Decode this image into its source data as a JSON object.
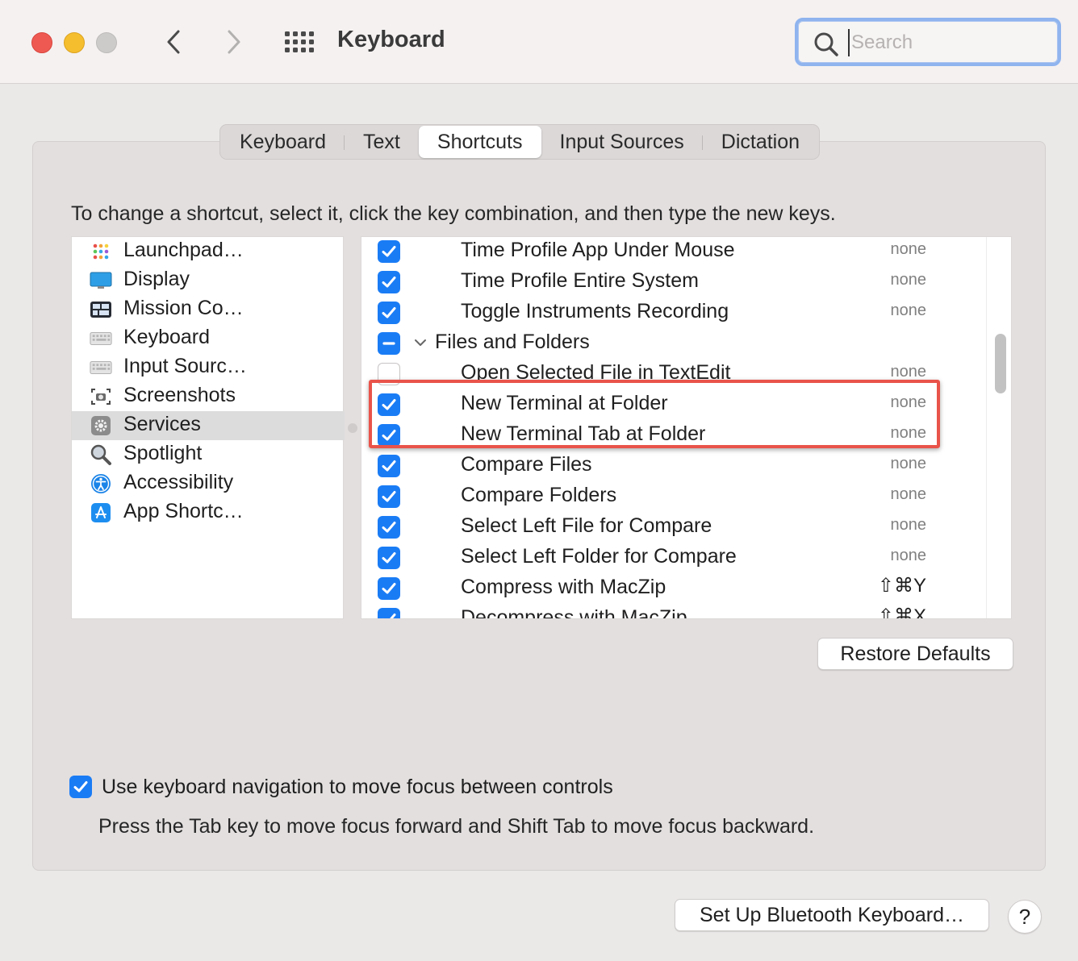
{
  "window": {
    "title": "Keyboard",
    "search_placeholder": "Search"
  },
  "tabs": [
    {
      "label": "Keyboard"
    },
    {
      "label": "Text"
    },
    {
      "label": "Shortcuts",
      "active": true
    },
    {
      "label": "Input Sources"
    },
    {
      "label": "Dictation"
    }
  ],
  "instruction": "To change a shortcut, select it, click the key combination, and then type the new keys.",
  "categories": [
    {
      "label": "Launchpad…",
      "icon": "launchpad-icon"
    },
    {
      "label": "Display",
      "icon": "display-icon"
    },
    {
      "label": "Mission Co…",
      "icon": "mission-control-icon"
    },
    {
      "label": "Keyboard",
      "icon": "keyboard-icon"
    },
    {
      "label": "Input Sourc…",
      "icon": "input-sources-icon"
    },
    {
      "label": "Screenshots",
      "icon": "screenshot-icon"
    },
    {
      "label": "Services",
      "icon": "gear-icon",
      "selected": true
    },
    {
      "label": "Spotlight",
      "icon": "magnifier-icon"
    },
    {
      "label": "Accessibility",
      "icon": "accessibility-icon"
    },
    {
      "label": "App Shortc…",
      "icon": "app-store-icon"
    }
  ],
  "shortcuts": [
    {
      "label": "Time Profile App Under Mouse",
      "shortcut": "none",
      "checked": "on"
    },
    {
      "label": "Time Profile Entire System",
      "shortcut": "none",
      "checked": "on"
    },
    {
      "label": "Toggle Instruments Recording",
      "shortcut": "none",
      "checked": "on"
    },
    {
      "label": "Files and Folders",
      "shortcut": "",
      "checked": "mixed",
      "group": true
    },
    {
      "label": "Open Selected File in TextEdit",
      "shortcut": "none",
      "checked": "off"
    },
    {
      "label": "New Terminal at Folder",
      "shortcut": "none",
      "checked": "on"
    },
    {
      "label": "New Terminal Tab at Folder",
      "shortcut": "none",
      "checked": "on"
    },
    {
      "label": "Compare Files",
      "shortcut": "none",
      "checked": "on"
    },
    {
      "label": "Compare Folders",
      "shortcut": "none",
      "checked": "on"
    },
    {
      "label": "Select Left File for Compare",
      "shortcut": "none",
      "checked": "on"
    },
    {
      "label": "Select Left Folder for Compare",
      "shortcut": "none",
      "checked": "on"
    },
    {
      "label": "Compress with MacZip",
      "shortcut": "⇧⌘Y",
      "checked": "on"
    },
    {
      "label": "Decompress with MacZip",
      "shortcut": "⇧⌘X",
      "checked": "on"
    }
  ],
  "buttons": {
    "restore_defaults": "Restore Defaults",
    "bluetooth": "Set Up Bluetooth Keyboard…",
    "help": "?"
  },
  "keyboard_navigation": {
    "checked": true,
    "label": "Use keyboard navigation to move focus between controls",
    "description": "Press the Tab key to move focus forward and Shift Tab to move focus backward."
  },
  "colors": {
    "accent": "#1a7cf5",
    "highlight_box": "#e9534a"
  }
}
